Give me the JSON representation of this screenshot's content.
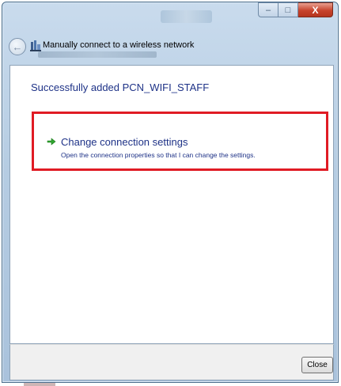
{
  "window": {
    "title": "Manually connect to a wireless network",
    "caption_buttons": {
      "minimize": "–",
      "maximize": "□",
      "close": "X"
    }
  },
  "nav": {
    "back_glyph": "←",
    "icons": [
      "back-icon",
      "wireless-network-icon"
    ]
  },
  "content": {
    "success_message": "Successfully added PCN_WIFI_STAFF",
    "option": {
      "icon": "green-arrow-icon",
      "title": "Change connection settings",
      "description": "Open the connection properties so that I can change the settings."
    }
  },
  "footer": {
    "close_label": "Close"
  },
  "colors": {
    "link_blue": "#1e3287",
    "highlight_red": "#e01b24",
    "arrow_green": "#2fa52f",
    "glass_blue": "#b5cce2",
    "close_red": "#c7432c"
  }
}
